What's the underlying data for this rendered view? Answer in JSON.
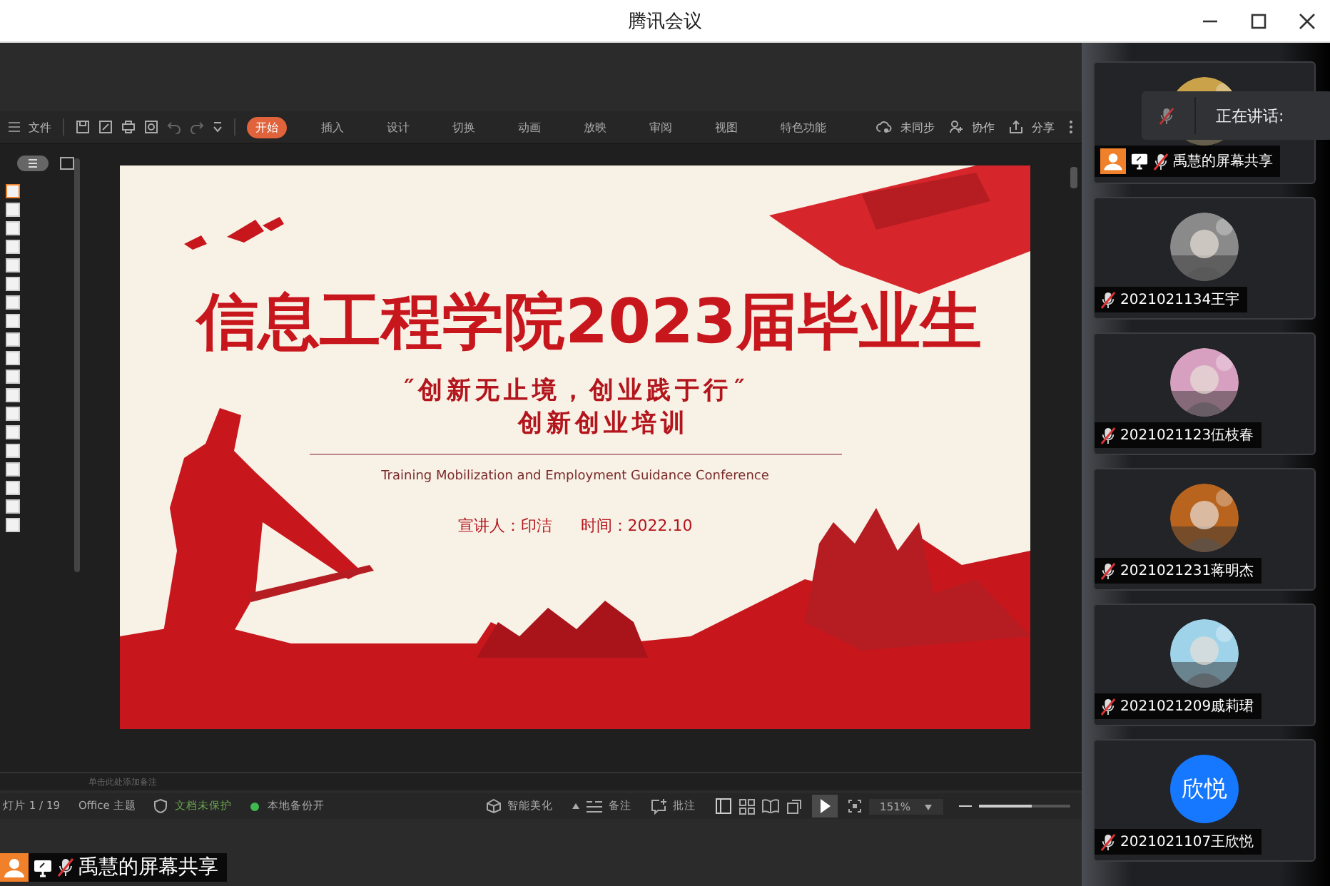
{
  "window": {
    "title": "腾讯会议"
  },
  "toolbar": {
    "menu": "文件",
    "tabs": [
      {
        "label": "开始",
        "selected": true
      },
      {
        "label": "插入",
        "selected": false
      },
      {
        "label": "设计",
        "selected": false
      },
      {
        "label": "切换",
        "selected": false
      },
      {
        "label": "动画",
        "selected": false
      },
      {
        "label": "放映",
        "selected": false
      },
      {
        "label": "审阅",
        "selected": false
      },
      {
        "label": "视图",
        "selected": false
      },
      {
        "label": "特色功能",
        "selected": false
      }
    ],
    "sync": "未同步",
    "collab": "协作",
    "share": "分享"
  },
  "thumbnails": [
    {
      "selected": true
    },
    {
      "selected": false
    },
    {
      "selected": false
    },
    {
      "selected": false
    },
    {
      "selected": false
    },
    {
      "selected": false
    },
    {
      "selected": false
    },
    {
      "selected": false
    },
    {
      "selected": false
    },
    {
      "selected": false
    },
    {
      "selected": false
    },
    {
      "selected": false
    },
    {
      "selected": false
    },
    {
      "selected": false
    },
    {
      "selected": false
    },
    {
      "selected": false
    },
    {
      "selected": false
    },
    {
      "selected": false
    },
    {
      "selected": false
    }
  ],
  "slide": {
    "title": "信息工程学院2023届毕业生",
    "slogan": "˝创新无止境，创业践于行˝",
    "subtitle": "创新创业培训",
    "english": "Training Mobilization and Employment Guidance Conference",
    "presenter": "宣讲人：印洁",
    "time": "时间：2022.10"
  },
  "notes_placeholder": "单击此处添加备注",
  "status_bar": {
    "slide_count": "灯片 1 / 19",
    "theme": "Office 主题",
    "protection": "文档未保护",
    "backup": "本地备份开",
    "beautify": "智能美化",
    "notes": "备注",
    "comment": "批注",
    "zoom": "151%",
    "zoom_slider": {
      "level": 0.58
    }
  },
  "speaking": {
    "label": "正在讲话:"
  },
  "participants": [
    {
      "name": "禹慧的屏幕共享",
      "sharing": true,
      "muted": true
    },
    {
      "name": "2021021134王宇",
      "sharing": false,
      "muted": true
    },
    {
      "name": "2021021123伍枝春",
      "sharing": false,
      "muted": true
    },
    {
      "name": "2021021231蒋明杰",
      "sharing": false,
      "muted": true
    },
    {
      "name": "2021021209戚莉珺",
      "sharing": false,
      "muted": true
    },
    {
      "name": "2021021107王欣悦",
      "sharing": false,
      "muted": true,
      "avatar": {
        "kind": "initials",
        "text": "欣悦"
      }
    }
  ],
  "share_label": {
    "name": "禹慧的屏幕共享",
    "muted": true
  }
}
